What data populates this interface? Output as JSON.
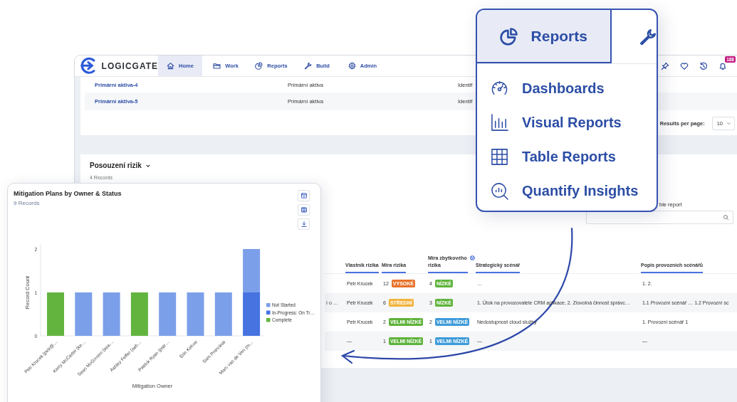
{
  "nav": {
    "logo": "LOGICGATE",
    "tabs": [
      {
        "label": "Home",
        "selected": true
      },
      {
        "label": "Work",
        "selected": false
      },
      {
        "label": "Reports",
        "selected": false
      },
      {
        "label": "Build",
        "selected": false
      },
      {
        "label": "Admin",
        "selected": false
      }
    ],
    "notification_count": "188"
  },
  "assets_table": {
    "rows": [
      {
        "name": "Primární aktiva-4",
        "type": "Primární aktiva",
        "column_3": "Identif"
      },
      {
        "name": "Primární aktiva-5",
        "type": "Primární aktiva",
        "column_3": "Identif"
      }
    ]
  },
  "pagination": {
    "label": "Results per page:",
    "value": "10"
  },
  "risk_section": {
    "title": "Posouzení rizik",
    "records": "4 Records",
    "search_label": "ble report",
    "columns": [
      {
        "sorted": false
      },
      {
        "label": "Vlastník rizika",
        "sorted": false
      },
      {
        "label": "Míra rizika",
        "sorted": false
      },
      {
        "label": "Míra zbytkového rizika",
        "sorted": true
      },
      {
        "label": "Strategický scénář",
        "sorted": false
      },
      {
        "label": "Popis provozních scénářů",
        "sorted": false
      }
    ],
    "rows": [
      {
        "owner": "Petr Krucek",
        "risk": {
          "score": "12",
          "badge": "VYSOKÉ",
          "color": "#e8722c"
        },
        "residual": {
          "score": "4",
          "badge": "NÍZKÉ",
          "color": "#5eb33b"
        },
        "strategic": "…",
        "operational": "1. 2."
      },
      {
        "column_1": "í o …",
        "owner": "Petr Krucek",
        "risk": {
          "score": "6",
          "badge": "STŘEDNÍ",
          "color": "#f2b23a"
        },
        "residual": {
          "score": "3",
          "badge": "NÍZKÉ",
          "color": "#5eb33b"
        },
        "strategic": "1. Útok na provozovatele CRM aplikace, 2. Zlovolná činnost správc…",
        "operational": "1.1 Provozní scénář … 1.2 Provozní sc"
      },
      {
        "owner": "Petr Krucek",
        "risk": {
          "score": "2",
          "badge": "VELMI NÍZKÉ",
          "color": "#5eb33b"
        },
        "residual": {
          "score": "2",
          "badge": "VELMI NÍZKÉ",
          "color": "#3e9bd9"
        },
        "strategic": "Nedostupnost cloud služby",
        "operational": "1. Provozní scénář 1"
      },
      {
        "owner": "—",
        "risk": {
          "score": "1",
          "badge": "VELMI NÍZKÉ",
          "color": "#5eb33b"
        },
        "residual": {
          "score": "1",
          "badge": "VELMI NÍZKÉ",
          "color": "#3e9bd9"
        },
        "strategic": "—",
        "operational": "—"
      }
    ]
  },
  "chart_card": {
    "title": "Mitigation Plans by Owner & Status",
    "records": "9 Records",
    "chart_data": {
      "type": "bar",
      "stacked": true,
      "xlabel": "Mitigation Owner",
      "ylabel": "Record Count",
      "categories": [
        "Petr Krucek (petr@…",
        "Kerry McCarter (ke…",
        "Sean McGovern (sea…",
        "Ashley Feffer (ash…",
        "Patrick Ryan (patr…",
        "Erin Kehoe",
        "Sam Pranckus",
        "Marc van de Ven (m…"
      ],
      "series": [
        {
          "name": "Not Started",
          "color": "#7c9fe9",
          "values": [
            0,
            1,
            1,
            0,
            1,
            1,
            1,
            1
          ]
        },
        {
          "name": "In-Progress: On Tr…",
          "color": "#4673e0",
          "values": [
            0,
            0,
            0,
            0,
            0,
            0,
            0,
            1
          ]
        },
        {
          "name": "Complete",
          "color": "#63b43f",
          "values": [
            1,
            0,
            0,
            1,
            0,
            0,
            0,
            0
          ]
        }
      ],
      "ylim": [
        0,
        2
      ],
      "yticks": [
        0,
        1,
        2
      ],
      "legend": "right"
    }
  },
  "reports_menu": {
    "tab": {
      "label": "Reports",
      "selected": true
    },
    "items": [
      {
        "label": "Dashboards"
      },
      {
        "label": "Visual Reports"
      },
      {
        "label": "Table Reports"
      },
      {
        "label": "Quantify Insights"
      }
    ]
  }
}
